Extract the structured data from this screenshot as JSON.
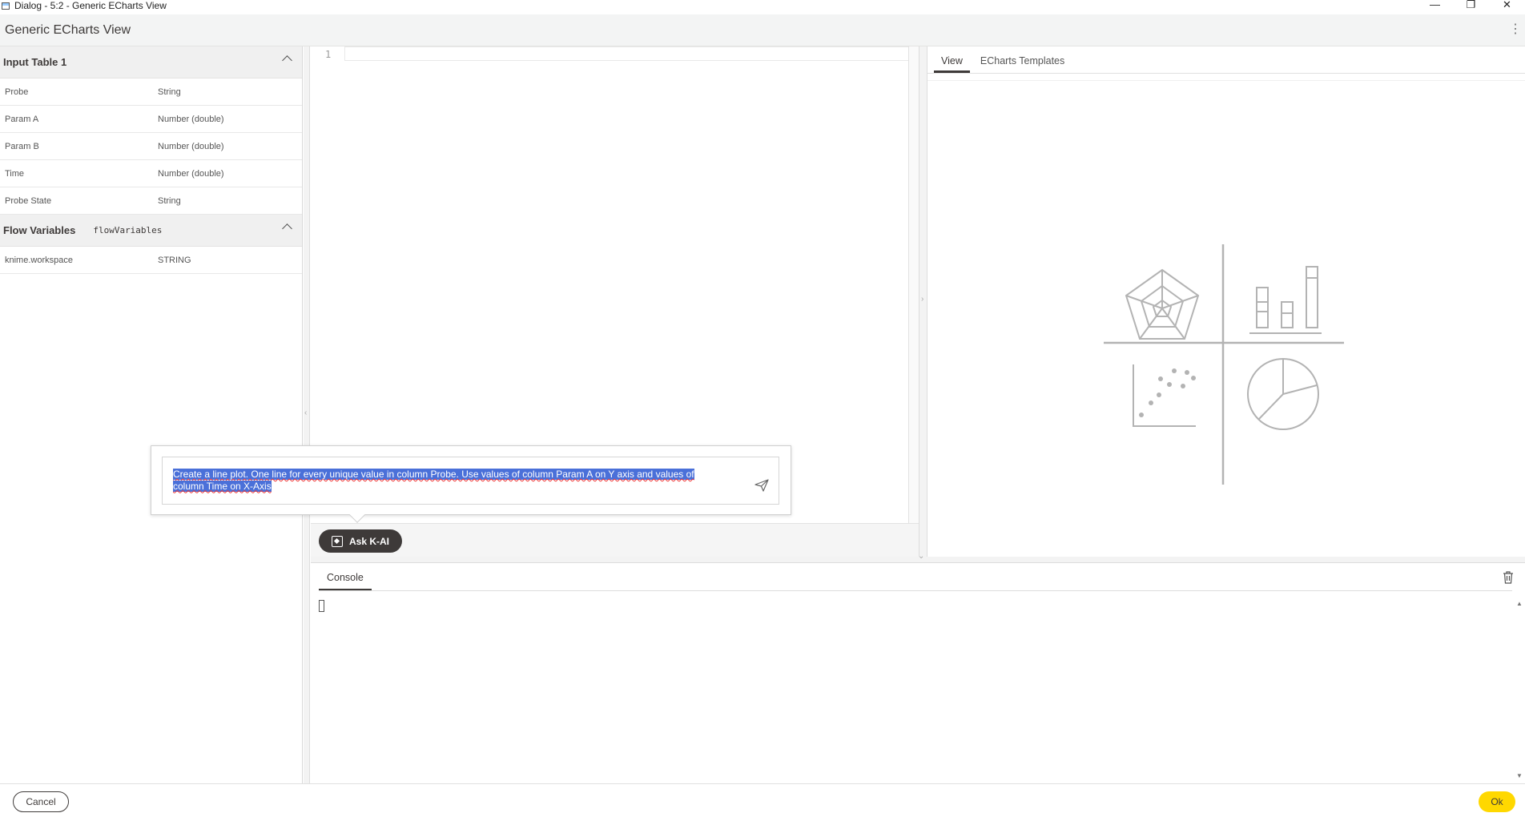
{
  "window": {
    "title": "Dialog - 5:2 - Generic ECharts View",
    "minimize": "—",
    "restore": "❐",
    "close": "✕"
  },
  "header": {
    "title": "Generic ECharts View",
    "menu_icon": "more-vertical-icon",
    "menu_glyph": "⋮"
  },
  "input_table": {
    "title": "Input Table 1",
    "columns": [
      {
        "name": "Probe",
        "type": "String"
      },
      {
        "name": "Param A",
        "type": "Number (double)"
      },
      {
        "name": "Param B",
        "type": "Number (double)"
      },
      {
        "name": "Time",
        "type": "Number (double)"
      },
      {
        "name": "Probe State",
        "type": "String"
      }
    ]
  },
  "flow_variables": {
    "title": "Flow Variables",
    "subtitle": "flowVariables",
    "items": [
      {
        "name": "knime.workspace",
        "type": "STRING"
      }
    ]
  },
  "editor": {
    "line_number": "1"
  },
  "ai": {
    "prompt": "Create a line plot. One line for every unique value in column Probe. Use values of column Param A on Y axis and values of column Time on X-Axis",
    "button_label": "Ask K-AI"
  },
  "view": {
    "tabs": [
      "View",
      "ECharts Templates"
    ],
    "active_tab": "View"
  },
  "console": {
    "tab_label": "Console"
  },
  "footer": {
    "cancel_label": "Cancel",
    "ok_label": "Ok"
  },
  "colors": {
    "accent_yellow": "#ffd800",
    "dark": "#3e3a39",
    "selection": "#4a70d9",
    "placeholder_gray": "#b3b3b3"
  }
}
